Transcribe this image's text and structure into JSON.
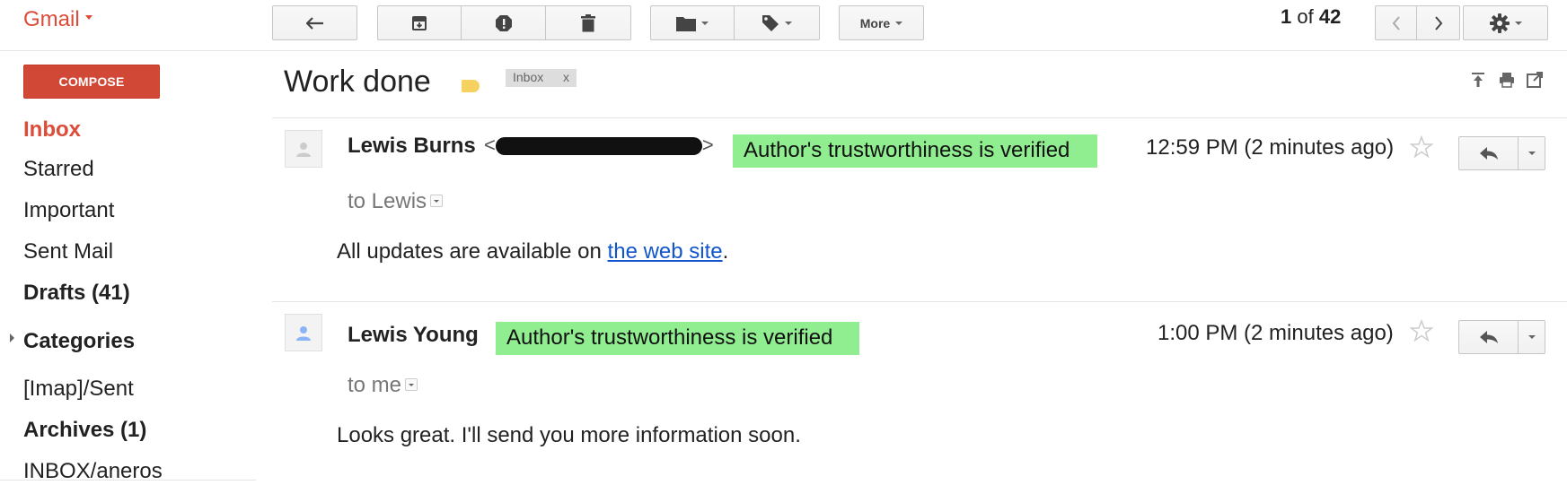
{
  "app": {
    "name": "Gmail"
  },
  "toolbar": {
    "back_icon": "back-arrow-icon",
    "archive_icon": "archive-icon",
    "spam_icon": "report-spam-icon",
    "delete_icon": "trash-icon",
    "move_icon": "folder-icon",
    "labels_icon": "label-icon",
    "more_label": "More",
    "pager": {
      "current": "1",
      "of": "of",
      "total": "42"
    },
    "settings_icon": "gear-icon"
  },
  "nav": {
    "compose_label": "COMPOSE",
    "items": [
      {
        "label": "Inbox",
        "active": true
      },
      {
        "label": "Starred"
      },
      {
        "label": "Important"
      },
      {
        "label": "Sent Mail"
      },
      {
        "label": "Drafts (41)",
        "bold": true
      },
      {
        "label": "Categories",
        "bold": true
      },
      {
        "label": "[Imap]/Sent"
      },
      {
        "label": "Archives (1)",
        "bold": true
      },
      {
        "label": "INBOX/aneros"
      }
    ]
  },
  "thread": {
    "subject": "Work done",
    "inbox_chip": {
      "label": "Inbox",
      "remove": "x"
    },
    "messages": [
      {
        "sender": "Lewis Burns",
        "email_open": "<",
        "email_close": ">",
        "verified_badge": "Author's trustworthiness is verified",
        "time": "12:59 PM (2 minutes ago)",
        "to": "to Lewis",
        "body_before": "All updates are available on ",
        "body_link": "the web site",
        "body_after": "."
      },
      {
        "sender": "Lewis Young",
        "verified_badge": "Author's trustworthiness is verified",
        "time": "1:00 PM (2 minutes ago)",
        "to": "to me",
        "body": "Looks great. I'll send you more information soon."
      }
    ]
  },
  "colors": {
    "brand": "#dd4b39",
    "compose": "#d14836",
    "verified": "#90ee90",
    "link": "#1155cc"
  }
}
